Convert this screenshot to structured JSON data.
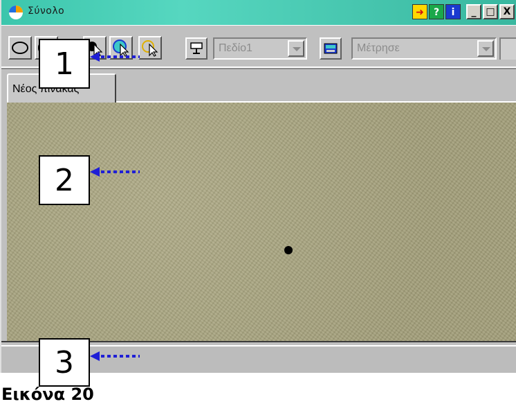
{
  "window": {
    "title": "Σύνολο",
    "titlebar_buttons": {
      "help_a": "➜",
      "help_b": "?",
      "info": "i",
      "minimize": "_",
      "maximize": "□",
      "close": "X"
    }
  },
  "toolbar": {
    "field_combo": {
      "value": "Πεδίο1"
    },
    "measure_combo": {
      "value": "Μέτρησε"
    },
    "tool_icons": [
      "ellipse-tool-icon",
      "rounded-rect-tool-icon",
      "select-arrow-icon",
      "fill-select-icon",
      "outline-select-icon",
      "field-icon",
      "calculator-icon"
    ]
  },
  "tabs": [
    {
      "label": "Νέος πίνακας"
    }
  ],
  "annotations": {
    "callout_1": "1",
    "callout_2": "2",
    "callout_3": "3",
    "arrow_color": "#1f1fd6"
  },
  "caption": "Εικόνα 20",
  "colors": {
    "titlebar": "#3cc6ac",
    "canvas": "#a8a481",
    "chrome": "#c0c0c0"
  }
}
